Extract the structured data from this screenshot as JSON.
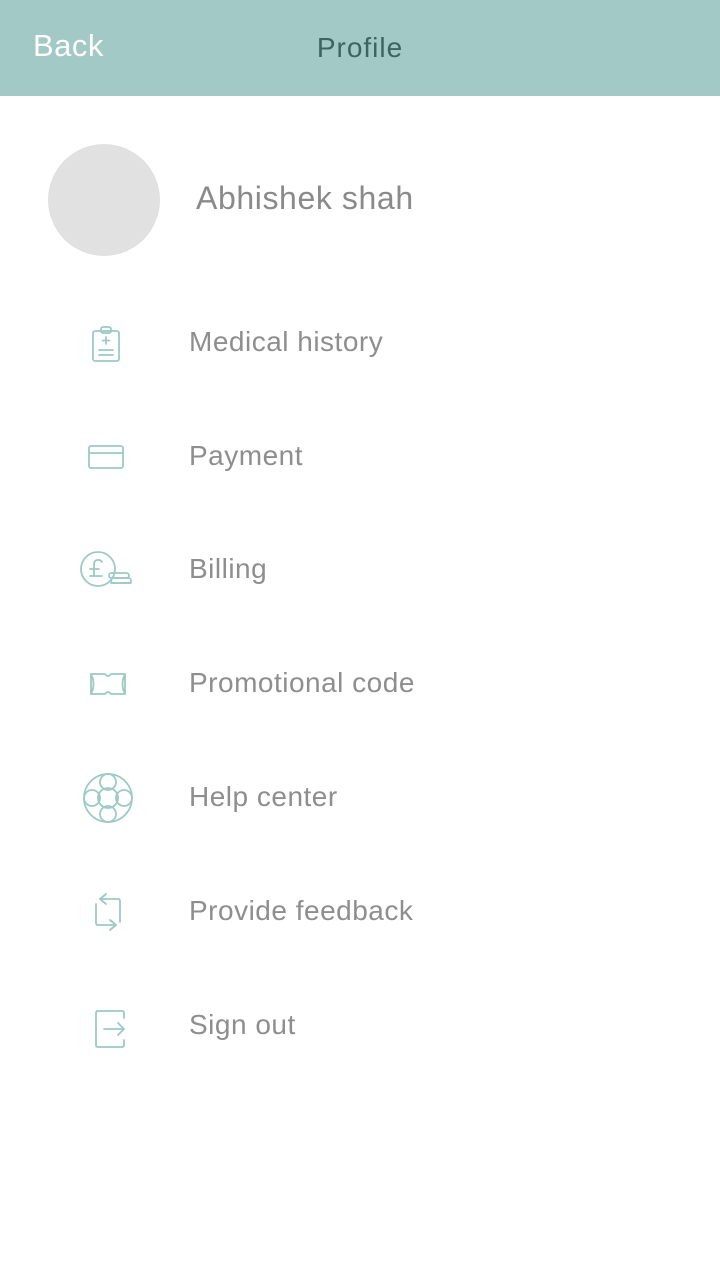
{
  "header": {
    "back_label": "Back",
    "title": "Profile",
    "background_color": "#a2c9c5"
  },
  "profile": {
    "name": "Abhishek shah"
  },
  "menu": {
    "items": [
      {
        "label": "Medical history",
        "icon": "clipboard-icon"
      },
      {
        "label": "Payment",
        "icon": "credit-card-icon"
      },
      {
        "label": "Billing",
        "icon": "pound-coins-icon"
      },
      {
        "label": "Promotional code",
        "icon": "ticket-icon"
      },
      {
        "label": "Help center",
        "icon": "lifebuoy-icon"
      },
      {
        "label": "Provide feedback",
        "icon": "feedback-arrows-icon"
      },
      {
        "label": "Sign out",
        "icon": "sign-out-icon"
      }
    ]
  },
  "colors": {
    "icon_stroke": "#9ccac4",
    "label_text": "#8e8e8e"
  }
}
